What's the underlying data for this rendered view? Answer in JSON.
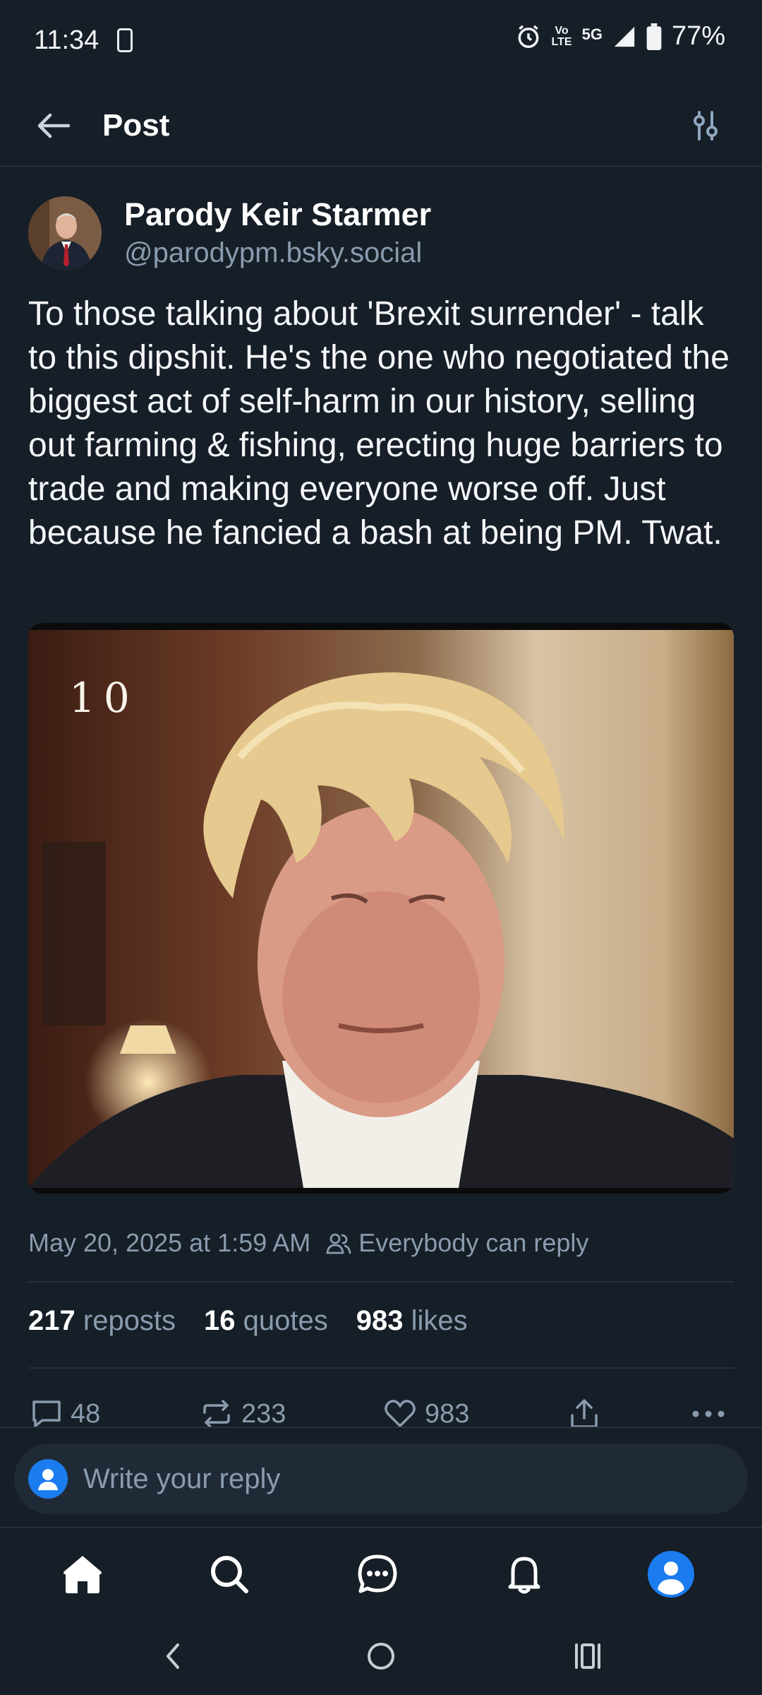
{
  "status_bar": {
    "time": "11:34",
    "volte_top": "Vo",
    "volte_bottom": "LTE",
    "network": "5G",
    "battery": "77%"
  },
  "header": {
    "title": "Post",
    "back_icon": "arrow-left-icon",
    "filter_icon": "sliders-icon"
  },
  "post": {
    "author_name": "Parody Keir Starmer",
    "author_handle": "@parodypm.bsky.social",
    "text": "To those talking about 'Brexit surrender' - talk to this dipshit. He's the one who negotiated the biggest act of self-harm in our history, selling out farming & fishing, erecting huge barriers to trade and making everyone worse off. Just because he fancied a bash at being PM. Twat.",
    "image_overlay_text": "10",
    "timestamp": "May 20, 2025 at 1:59 AM",
    "reply_setting": "Everybody can reply",
    "stats": {
      "reposts_count": "217",
      "reposts_label": "reposts",
      "quotes_count": "16",
      "quotes_label": "quotes",
      "likes_count": "983",
      "likes_label": "likes"
    },
    "actions": {
      "replies": "48",
      "reposts": "233",
      "likes": "983"
    }
  },
  "reply_bar": {
    "placeholder": "Write your reply"
  },
  "bottom_nav": [
    "home-icon",
    "search-icon",
    "chat-icon",
    "bell-icon",
    "profile-icon"
  ],
  "colors": {
    "background": "#161e27",
    "accent": "#1b7cf0",
    "muted": "#8a9bae"
  }
}
